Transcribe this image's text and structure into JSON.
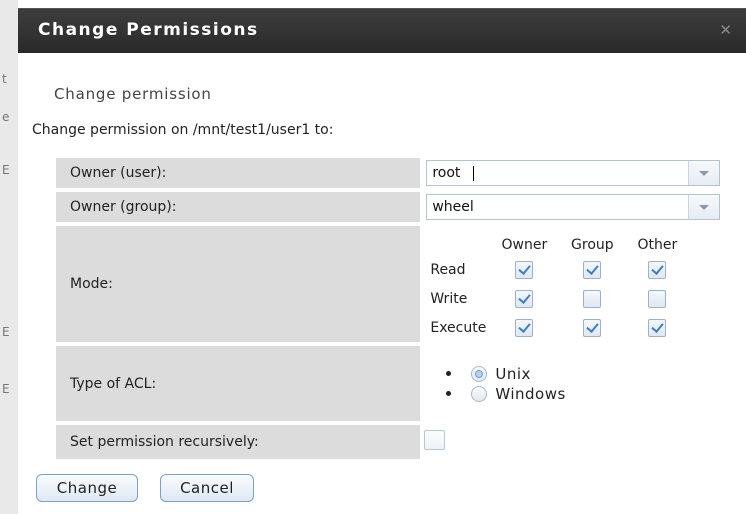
{
  "background": {
    "fragments": [
      "t",
      "e",
      "E",
      "E",
      "E"
    ]
  },
  "dialog": {
    "title": "Change Permissions",
    "close_glyph": "✕",
    "subheading": "Change permission",
    "intro": "Change permission on /mnt/test1/user1 to:"
  },
  "form": {
    "owner_user": {
      "label": "Owner (user):",
      "value": "root"
    },
    "owner_group": {
      "label": "Owner (group):",
      "value": "wheel"
    },
    "mode": {
      "label": "Mode:",
      "columns": [
        "Owner",
        "Group",
        "Other"
      ],
      "rows": [
        {
          "label": "Read",
          "checked": [
            true,
            true,
            true
          ]
        },
        {
          "label": "Write",
          "checked": [
            true,
            false,
            false
          ]
        },
        {
          "label": "Execute",
          "checked": [
            true,
            true,
            true
          ]
        }
      ]
    },
    "acl": {
      "label": "Type of ACL:",
      "options": [
        {
          "label": "Unix",
          "selected": true
        },
        {
          "label": "Windows",
          "selected": false
        }
      ]
    },
    "recursive": {
      "label": "Set permission recursively:",
      "checked": false
    }
  },
  "buttons": {
    "change": "Change",
    "cancel": "Cancel"
  },
  "colors": {
    "titlebar": "#2f2f2f",
    "label_bg": "#dcdcdc",
    "accent": "#3d7fc8",
    "button_border": "#7aa0cc"
  }
}
